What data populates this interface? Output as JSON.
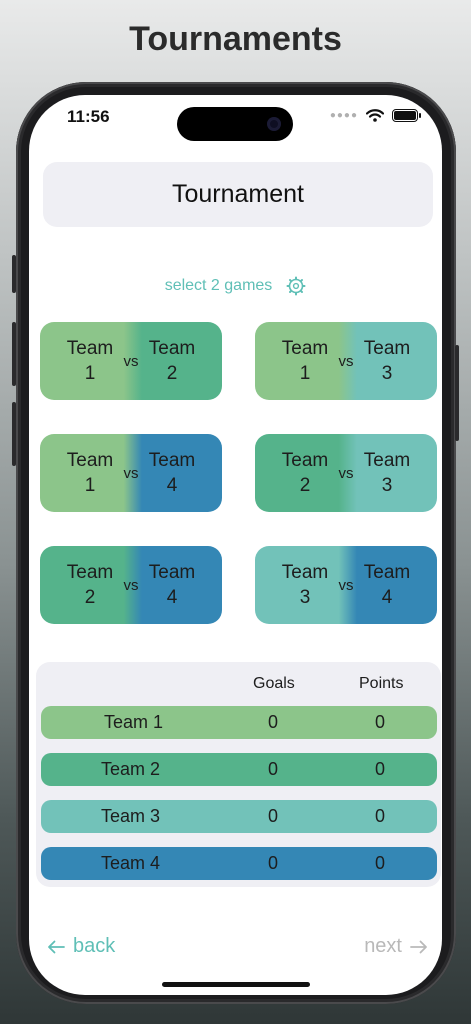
{
  "page_title": "Tournaments",
  "status_bar": {
    "time": "11:56"
  },
  "tournament_title": "Tournament",
  "select_games": {
    "label": "select 2 games"
  },
  "games": [
    {
      "team_a": "Team\n1",
      "vs": "vs",
      "team_b": "Team\n2"
    },
    {
      "team_a": "Team\n1",
      "vs": "vs",
      "team_b": "Team\n3"
    },
    {
      "team_a": "Team\n1",
      "vs": "vs",
      "team_b": "Team\n4"
    },
    {
      "team_a": "Team\n2",
      "vs": "vs",
      "team_b": "Team\n3"
    },
    {
      "team_a": "Team\n2",
      "vs": "vs",
      "team_b": "Team\n4"
    },
    {
      "team_a": "Team\n3",
      "vs": "vs",
      "team_b": "Team\n4"
    }
  ],
  "standings": {
    "headers": {
      "goals": "Goals",
      "points": "Points"
    },
    "rows": [
      {
        "team": "Team 1",
        "goals": "0",
        "points": "0",
        "color": "#8cc58a"
      },
      {
        "team": "Team 2",
        "goals": "0",
        "points": "0",
        "color": "#55b38b"
      },
      {
        "team": "Team 3",
        "goals": "0",
        "points": "0",
        "color": "#72c2b9"
      },
      {
        "team": "Team 4",
        "goals": "0",
        "points": "0",
        "color": "#3487b5"
      }
    ]
  },
  "nav": {
    "back_label": "back",
    "next_label": "next"
  },
  "colors": {
    "team1": "#8cc58a",
    "team2": "#55b38b",
    "team3": "#72c2b9",
    "team4": "#3487b5",
    "accent": "#5fbfb6",
    "disabled": "#b9b9b9"
  }
}
